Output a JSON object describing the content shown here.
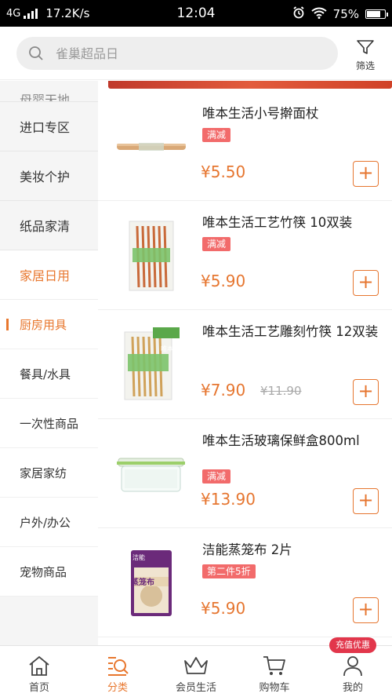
{
  "status_bar": {
    "network": "4G",
    "speed": "17.2K/s",
    "time": "12:04",
    "battery": "75%"
  },
  "search": {
    "placeholder": "雀巢超品日",
    "filter_label": "筛选"
  },
  "sidebar": {
    "partial_top": "母婴天地",
    "categories_top": [
      "进口专区",
      "美妆个护",
      "纸品家清"
    ],
    "active_category": "家居日用",
    "subcategories": [
      {
        "label": "厨房用具",
        "active": true
      },
      {
        "label": "餐具/水具",
        "active": false
      },
      {
        "label": "一次性商品",
        "active": false
      },
      {
        "label": "家居家纺",
        "active": false
      },
      {
        "label": "户外/办公",
        "active": false
      },
      {
        "label": "宠物商品",
        "active": false
      }
    ]
  },
  "products": [
    {
      "title": "唯本生活小号擀面杖",
      "tag": "满减",
      "price": "¥5.50",
      "old_price": ""
    },
    {
      "title": "唯本生活工艺竹筷 10双装",
      "tag": "满减",
      "price": "¥5.90",
      "old_price": ""
    },
    {
      "title": "唯本生活工艺雕刻竹筷 12双装",
      "tag": "",
      "price": "¥7.90",
      "old_price": "¥11.90"
    },
    {
      "title": "唯本生活玻璃保鲜盒800ml",
      "tag": "满减",
      "price": "¥13.90",
      "old_price": ""
    },
    {
      "title": "洁能蒸笼布 2片",
      "tag": "第二件5折",
      "price": "¥5.90",
      "old_price": ""
    }
  ],
  "product_images": {
    "chopsticks_brand": "唯本生活",
    "steamer_brand": "洁能",
    "steamer_label": "蒸笼布"
  },
  "add_button_label": "+",
  "tabbar": {
    "tabs": [
      {
        "label": "首页",
        "icon": "home-icon"
      },
      {
        "label": "分类",
        "icon": "category-search-icon"
      },
      {
        "label": "会员生活",
        "icon": "crown-icon"
      },
      {
        "label": "购物车",
        "icon": "cart-icon"
      },
      {
        "label": "我的",
        "icon": "user-icon"
      }
    ],
    "active_tab": "分类",
    "promo_badge": "充值优惠"
  },
  "colors": {
    "accent": "#e8772e",
    "tag_red": "#f26b6b",
    "promo": "#e2364b"
  }
}
